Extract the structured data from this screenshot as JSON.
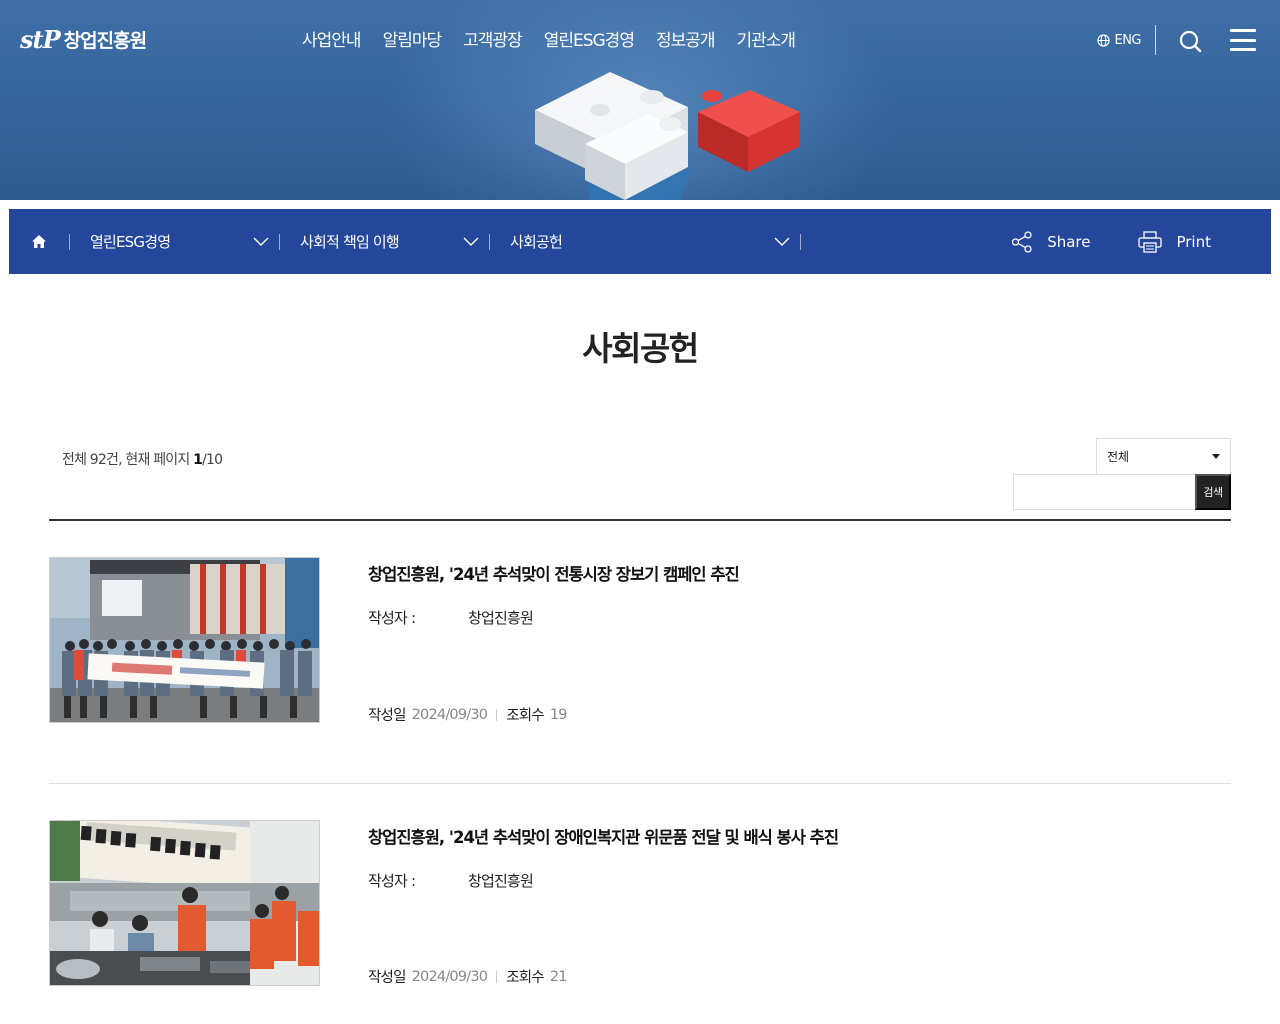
{
  "header": {
    "logo_mark": "stP",
    "logo_text": "창업진흥원",
    "gnb": [
      "사업안내",
      "알림마당",
      "고객광장",
      "열린ESG경영",
      "정보공개",
      "기관소개"
    ],
    "lang_label": "ENG"
  },
  "locbar": {
    "crumbs": [
      "열린ESG경영",
      "사회적 책임 이행",
      "사회공헌"
    ],
    "share_label": "Share",
    "print_label": "Print"
  },
  "main": {
    "title": "사회공헌",
    "count_prefix": "전체 92건, 현재 페이지",
    "count_page": "1",
    "count_total": "/10",
    "filter_value": "전체",
    "search_button": "검색"
  },
  "posts": [
    {
      "title": "창업진흥원, '24년 추석맞이 전통시장 장보기 캠페인 추진",
      "writer_label": "작성자 :",
      "writer": "창업진흥원",
      "date_label": "작성일",
      "date": "2024/09/30",
      "views_label": "조회수",
      "views": "19"
    },
    {
      "title": "창업진흥원, '24년 추석맞이 장애인복지관 위문품 전달 및 배식 봉사 추진",
      "writer_label": "작성자 :",
      "writer": "창업진흥원",
      "date_label": "작성일",
      "date": "2024/09/30",
      "views_label": "조회수",
      "views": "21"
    }
  ],
  "colors": {
    "hero_blue": "#35669d",
    "locbar_blue": "#24479c",
    "puzzle_red": "#e03a36"
  },
  "icons": [
    "globe-icon",
    "search-icon",
    "hamburger-menu-icon",
    "home-icon",
    "chevron-down-icon",
    "share-icon",
    "print-icon"
  ]
}
